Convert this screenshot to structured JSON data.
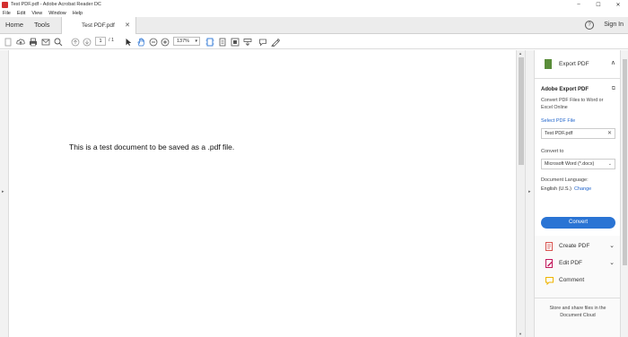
{
  "window": {
    "title": "Test PDF.pdf - Adobe Acrobat Reader DC",
    "minimize": "–",
    "maximize": "☐",
    "close": "✕"
  },
  "menu": [
    "File",
    "Edit",
    "View",
    "Window",
    "Help"
  ],
  "tabs": {
    "home": "Home",
    "tools": "Tools",
    "doc_tab": "Test PDF.pdf",
    "doc_tab_close": "✕",
    "help": "?",
    "signin": "Sign In"
  },
  "toolbar": {
    "page_current": "1",
    "page_total": "/ 1",
    "zoom": "137%",
    "zoom_caret": "▾",
    "icons": [
      "create-icon",
      "cloud-upload-icon",
      "print-icon",
      "email-icon",
      "search-icon",
      "page-up-icon",
      "page-down-icon",
      "select-cursor-icon",
      "hand-icon",
      "zoom-out-icon",
      "zoom-in-icon",
      "fit-page-icon",
      "scroll-icon",
      "fullscreen-icon",
      "read-aloud-icon",
      "comment-icon",
      "highlight-icon"
    ]
  },
  "document": {
    "text": "This is a test document to be saved as a .pdf file."
  },
  "right_panel": {
    "header_title": "Export PDF",
    "header_caret": "∧",
    "export": {
      "title": "Adobe Export PDF",
      "description": "Convert PDF Files to Word or Excel Online",
      "select_label": "Select PDF File",
      "file_name": "Test PDF.pdf",
      "file_clear": "✕",
      "convert_to_label": "Convert to",
      "format": "Microsoft Word (*.docx)",
      "format_caret": "⌄",
      "language_label": "Document Language:",
      "language": "English (U.S.)",
      "change": "Change",
      "convert_button": "Convert"
    },
    "tools": [
      {
        "label": "Create PDF",
        "caret": "⌄",
        "icon": "create-pdf-icon",
        "color": "#d9534f"
      },
      {
        "label": "Edit PDF",
        "caret": "⌄",
        "icon": "edit-pdf-icon",
        "color": "#c2185b"
      },
      {
        "label": "Comment",
        "caret": "",
        "icon": "comment-icon",
        "color": "#f0b400"
      }
    ],
    "footer": "Store and share files in the Document Cloud"
  },
  "colors": {
    "accent_blue": "#2a74d4",
    "export_green": "#5a8d3a"
  }
}
